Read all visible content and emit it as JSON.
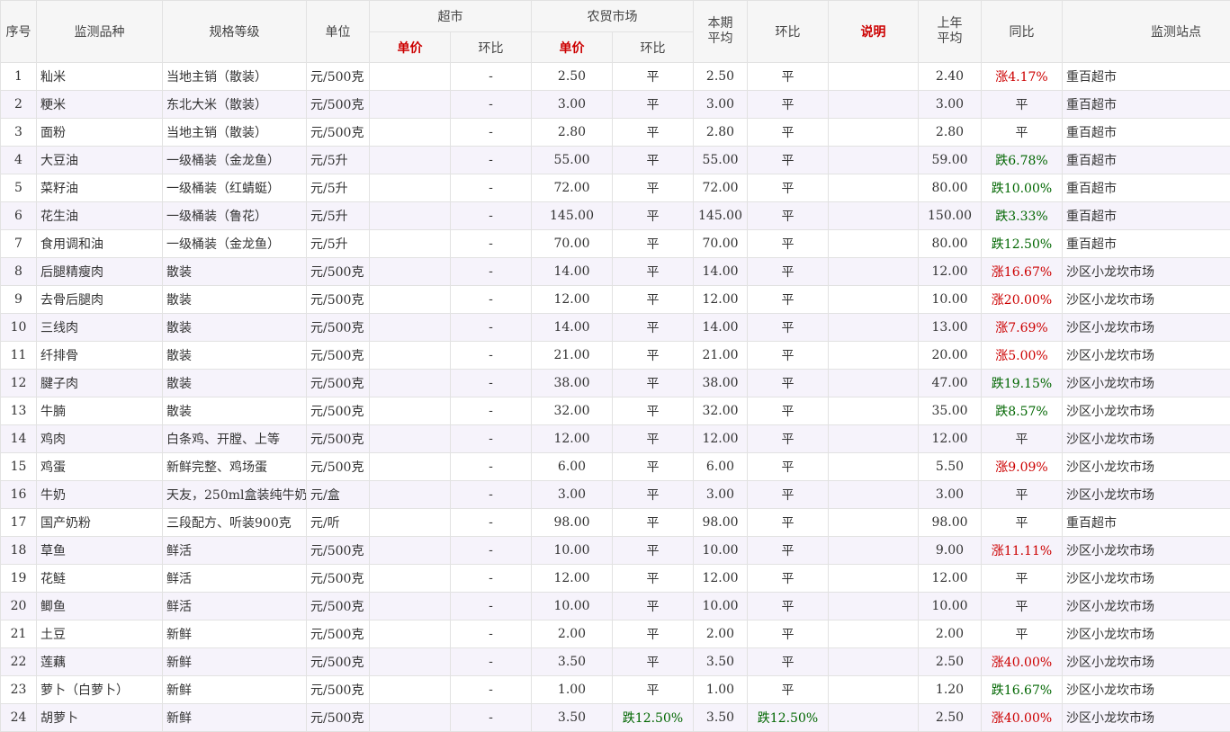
{
  "headers": {
    "seq": "序号",
    "variety": "监测品种",
    "spec": "规格等级",
    "unit": "单位",
    "supermarket": "超市",
    "market": "农贸市场",
    "period_avg_line1": "本期",
    "period_avg_line2": "平均",
    "mom": "环比",
    "note": "说明",
    "last_year_line1": "上年",
    "last_year_line2": "平均",
    "yoy": "同比",
    "site": "监测站点",
    "sub_unit_price": "单价",
    "sub_mom": "环比"
  },
  "colors": {
    "up": "#cc0000",
    "down": "#006600",
    "header_highlight": "#cc0000"
  },
  "rows": [
    {
      "seq": "1",
      "variety": "籼米",
      "spec": "当地主销（散装）",
      "unit": "元/500克",
      "sm_price": "",
      "sm_mom": "-",
      "mk_price": "2.50",
      "mk_mom": "平",
      "mk_mom_dir": "",
      "avg": "2.50",
      "mom": "平",
      "mom_dir": "",
      "note": "",
      "last": "2.40",
      "yoy": "涨4.17%",
      "yoy_dir": "up",
      "site": "重百超市"
    },
    {
      "seq": "2",
      "variety": "粳米",
      "spec": "东北大米（散装）",
      "unit": "元/500克",
      "sm_price": "",
      "sm_mom": "-",
      "mk_price": "3.00",
      "mk_mom": "平",
      "mk_mom_dir": "",
      "avg": "3.00",
      "mom": "平",
      "mom_dir": "",
      "note": "",
      "last": "3.00",
      "yoy": "平",
      "yoy_dir": "",
      "site": "重百超市"
    },
    {
      "seq": "3",
      "variety": "面粉",
      "spec": "当地主销（散装）",
      "unit": "元/500克",
      "sm_price": "",
      "sm_mom": "-",
      "mk_price": "2.80",
      "mk_mom": "平",
      "mk_mom_dir": "",
      "avg": "2.80",
      "mom": "平",
      "mom_dir": "",
      "note": "",
      "last": "2.80",
      "yoy": "平",
      "yoy_dir": "",
      "site": "重百超市"
    },
    {
      "seq": "4",
      "variety": "大豆油",
      "spec": "一级桶装（金龙鱼）",
      "unit": "元/5升",
      "sm_price": "",
      "sm_mom": "-",
      "mk_price": "55.00",
      "mk_mom": "平",
      "mk_mom_dir": "",
      "avg": "55.00",
      "mom": "平",
      "mom_dir": "",
      "note": "",
      "last": "59.00",
      "yoy": "跌6.78%",
      "yoy_dir": "down",
      "site": "重百超市"
    },
    {
      "seq": "5",
      "variety": "菜籽油",
      "spec": "一级桶装（红蜻蜓）",
      "unit": "元/5升",
      "sm_price": "",
      "sm_mom": "-",
      "mk_price": "72.00",
      "mk_mom": "平",
      "mk_mom_dir": "",
      "avg": "72.00",
      "mom": "平",
      "mom_dir": "",
      "note": "",
      "last": "80.00",
      "yoy": "跌10.00%",
      "yoy_dir": "down",
      "site": "重百超市"
    },
    {
      "seq": "6",
      "variety": "花生油",
      "spec": "一级桶装（鲁花）",
      "unit": "元/5升",
      "sm_price": "",
      "sm_mom": "-",
      "mk_price": "145.00",
      "mk_mom": "平",
      "mk_mom_dir": "",
      "avg": "145.00",
      "mom": "平",
      "mom_dir": "",
      "note": "",
      "last": "150.00",
      "yoy": "跌3.33%",
      "yoy_dir": "down",
      "site": "重百超市"
    },
    {
      "seq": "7",
      "variety": "食用调和油",
      "spec": "一级桶装（金龙鱼）",
      "unit": "元/5升",
      "sm_price": "",
      "sm_mom": "-",
      "mk_price": "70.00",
      "mk_mom": "平",
      "mk_mom_dir": "",
      "avg": "70.00",
      "mom": "平",
      "mom_dir": "",
      "note": "",
      "last": "80.00",
      "yoy": "跌12.50%",
      "yoy_dir": "down",
      "site": "重百超市"
    },
    {
      "seq": "8",
      "variety": "后腿精瘦肉",
      "spec": "散装",
      "unit": "元/500克",
      "sm_price": "",
      "sm_mom": "-",
      "mk_price": "14.00",
      "mk_mom": "平",
      "mk_mom_dir": "",
      "avg": "14.00",
      "mom": "平",
      "mom_dir": "",
      "note": "",
      "last": "12.00",
      "yoy": "涨16.67%",
      "yoy_dir": "up",
      "site": "沙区小龙坎市场"
    },
    {
      "seq": "9",
      "variety": "去骨后腿肉",
      "spec": "散装",
      "unit": "元/500克",
      "sm_price": "",
      "sm_mom": "-",
      "mk_price": "12.00",
      "mk_mom": "平",
      "mk_mom_dir": "",
      "avg": "12.00",
      "mom": "平",
      "mom_dir": "",
      "note": "",
      "last": "10.00",
      "yoy": "涨20.00%",
      "yoy_dir": "up",
      "site": "沙区小龙坎市场"
    },
    {
      "seq": "10",
      "variety": "三线肉",
      "spec": "散装",
      "unit": "元/500克",
      "sm_price": "",
      "sm_mom": "-",
      "mk_price": "14.00",
      "mk_mom": "平",
      "mk_mom_dir": "",
      "avg": "14.00",
      "mom": "平",
      "mom_dir": "",
      "note": "",
      "last": "13.00",
      "yoy": "涨7.69%",
      "yoy_dir": "up",
      "site": "沙区小龙坎市场"
    },
    {
      "seq": "11",
      "variety": "纤排骨",
      "spec": "散装",
      "unit": "元/500克",
      "sm_price": "",
      "sm_mom": "-",
      "mk_price": "21.00",
      "mk_mom": "平",
      "mk_mom_dir": "",
      "avg": "21.00",
      "mom": "平",
      "mom_dir": "",
      "note": "",
      "last": "20.00",
      "yoy": "涨5.00%",
      "yoy_dir": "up",
      "site": "沙区小龙坎市场"
    },
    {
      "seq": "12",
      "variety": "腱子肉",
      "spec": "散装",
      "unit": "元/500克",
      "sm_price": "",
      "sm_mom": "-",
      "mk_price": "38.00",
      "mk_mom": "平",
      "mk_mom_dir": "",
      "avg": "38.00",
      "mom": "平",
      "mom_dir": "",
      "note": "",
      "last": "47.00",
      "yoy": "跌19.15%",
      "yoy_dir": "down",
      "site": "沙区小龙坎市场"
    },
    {
      "seq": "13",
      "variety": "牛腩",
      "spec": "散装",
      "unit": "元/500克",
      "sm_price": "",
      "sm_mom": "-",
      "mk_price": "32.00",
      "mk_mom": "平",
      "mk_mom_dir": "",
      "avg": "32.00",
      "mom": "平",
      "mom_dir": "",
      "note": "",
      "last": "35.00",
      "yoy": "跌8.57%",
      "yoy_dir": "down",
      "site": "沙区小龙坎市场"
    },
    {
      "seq": "14",
      "variety": "鸡肉",
      "spec": "白条鸡、开膛、上等",
      "unit": "元/500克",
      "sm_price": "",
      "sm_mom": "-",
      "mk_price": "12.00",
      "mk_mom": "平",
      "mk_mom_dir": "",
      "avg": "12.00",
      "mom": "平",
      "mom_dir": "",
      "note": "",
      "last": "12.00",
      "yoy": "平",
      "yoy_dir": "",
      "site": "沙区小龙坎市场"
    },
    {
      "seq": "15",
      "variety": "鸡蛋",
      "spec": "新鲜完整、鸡场蛋",
      "unit": "元/500克",
      "sm_price": "",
      "sm_mom": "-",
      "mk_price": "6.00",
      "mk_mom": "平",
      "mk_mom_dir": "",
      "avg": "6.00",
      "mom": "平",
      "mom_dir": "",
      "note": "",
      "last": "5.50",
      "yoy": "涨9.09%",
      "yoy_dir": "up",
      "site": "沙区小龙坎市场"
    },
    {
      "seq": "16",
      "variety": "牛奶",
      "spec": "天友，250ml盒装纯牛奶",
      "unit": "元/盒",
      "sm_price": "",
      "sm_mom": "-",
      "mk_price": "3.00",
      "mk_mom": "平",
      "mk_mom_dir": "",
      "avg": "3.00",
      "mom": "平",
      "mom_dir": "",
      "note": "",
      "last": "3.00",
      "yoy": "平",
      "yoy_dir": "",
      "site": "沙区小龙坎市场"
    },
    {
      "seq": "17",
      "variety": "国产奶粉",
      "spec": "三段配方、听装900克",
      "unit": "元/听",
      "sm_price": "",
      "sm_mom": "-",
      "mk_price": "98.00",
      "mk_mom": "平",
      "mk_mom_dir": "",
      "avg": "98.00",
      "mom": "平",
      "mom_dir": "",
      "note": "",
      "last": "98.00",
      "yoy": "平",
      "yoy_dir": "",
      "site": "重百超市"
    },
    {
      "seq": "18",
      "variety": "草鱼",
      "spec": "鲜活",
      "unit": "元/500克",
      "sm_price": "",
      "sm_mom": "-",
      "mk_price": "10.00",
      "mk_mom": "平",
      "mk_mom_dir": "",
      "avg": "10.00",
      "mom": "平",
      "mom_dir": "",
      "note": "",
      "last": "9.00",
      "yoy": "涨11.11%",
      "yoy_dir": "up",
      "site": "沙区小龙坎市场"
    },
    {
      "seq": "19",
      "variety": "花鲢",
      "spec": "鲜活",
      "unit": "元/500克",
      "sm_price": "",
      "sm_mom": "-",
      "mk_price": "12.00",
      "mk_mom": "平",
      "mk_mom_dir": "",
      "avg": "12.00",
      "mom": "平",
      "mom_dir": "",
      "note": "",
      "last": "12.00",
      "yoy": "平",
      "yoy_dir": "",
      "site": "沙区小龙坎市场"
    },
    {
      "seq": "20",
      "variety": "鲫鱼",
      "spec": "鲜活",
      "unit": "元/500克",
      "sm_price": "",
      "sm_mom": "-",
      "mk_price": "10.00",
      "mk_mom": "平",
      "mk_mom_dir": "",
      "avg": "10.00",
      "mom": "平",
      "mom_dir": "",
      "note": "",
      "last": "10.00",
      "yoy": "平",
      "yoy_dir": "",
      "site": "沙区小龙坎市场"
    },
    {
      "seq": "21",
      "variety": "土豆",
      "spec": "新鲜",
      "unit": "元/500克",
      "sm_price": "",
      "sm_mom": "-",
      "mk_price": "2.00",
      "mk_mom": "平",
      "mk_mom_dir": "",
      "avg": "2.00",
      "mom": "平",
      "mom_dir": "",
      "note": "",
      "last": "2.00",
      "yoy": "平",
      "yoy_dir": "",
      "site": "沙区小龙坎市场"
    },
    {
      "seq": "22",
      "variety": "莲藕",
      "spec": "新鲜",
      "unit": "元/500克",
      "sm_price": "",
      "sm_mom": "-",
      "mk_price": "3.50",
      "mk_mom": "平",
      "mk_mom_dir": "",
      "avg": "3.50",
      "mom": "平",
      "mom_dir": "",
      "note": "",
      "last": "2.50",
      "yoy": "涨40.00%",
      "yoy_dir": "up",
      "site": "沙区小龙坎市场"
    },
    {
      "seq": "23",
      "variety": "萝卜（白萝卜）",
      "spec": "新鲜",
      "unit": "元/500克",
      "sm_price": "",
      "sm_mom": "-",
      "mk_price": "1.00",
      "mk_mom": "平",
      "mk_mom_dir": "",
      "avg": "1.00",
      "mom": "平",
      "mom_dir": "",
      "note": "",
      "last": "1.20",
      "yoy": "跌16.67%",
      "yoy_dir": "down",
      "site": "沙区小龙坎市场"
    },
    {
      "seq": "24",
      "variety": "胡萝卜",
      "spec": "新鲜",
      "unit": "元/500克",
      "sm_price": "",
      "sm_mom": "-",
      "mk_price": "3.50",
      "mk_mom": "跌12.50%",
      "mk_mom_dir": "down",
      "avg": "3.50",
      "mom": "跌12.50%",
      "mom_dir": "down",
      "note": "",
      "last": "2.50",
      "yoy": "涨40.00%",
      "yoy_dir": "up",
      "site": "沙区小龙坎市场"
    }
  ]
}
